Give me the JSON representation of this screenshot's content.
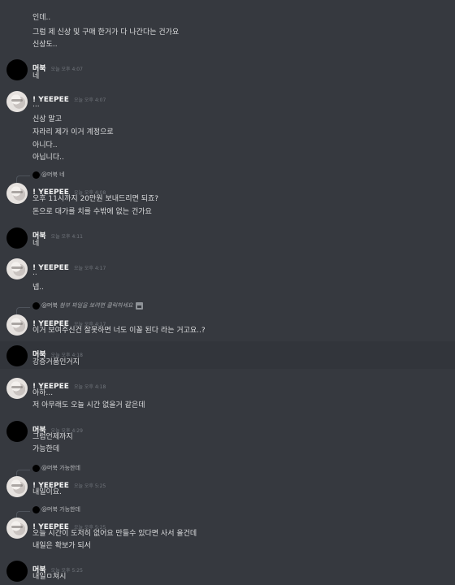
{
  "colors": {
    "background": "#36393f",
    "highlight_row": "#32353b",
    "text": "#dcddde",
    "username": "#ffffff",
    "timestamp": "#72767d"
  },
  "continuation": {
    "lines": [
      "인데..",
      "그럼 제 신상 및 구매 한거가 다 나간다는 건가요",
      "신상도.."
    ]
  },
  "messages": [
    {
      "author": "머북",
      "time": "오늘 오후 4:07",
      "avatar": "black-avatar",
      "lines": [
        "네"
      ]
    },
    {
      "author": "! YEEPEE",
      "time": "오늘 오후 4:07",
      "avatar": "anime-avatar",
      "lines": [
        "...",
        "신상 말고",
        "자라리 제가 이거 계정으로",
        "아니다..",
        "아닙니다.."
      ]
    },
    {
      "reply_to": "@머북",
      "reply_text": "네",
      "author": "! YEEPEE",
      "time": "오늘 오후 4:08",
      "avatar": "anime-avatar",
      "lines": [
        "오후 11시까지 20만원 보내드리면 되죠?",
        "돈으로 대가를 치를 수밖에 없는 건가요"
      ]
    },
    {
      "author": "머북",
      "time": "오늘 오후 4:11",
      "avatar": "black-avatar",
      "lines": [
        "네"
      ]
    },
    {
      "author": "! YEEPEE",
      "time": "오늘 오후 4:17",
      "avatar": "anime-avatar",
      "lines": [
        "..",
        "넵.."
      ]
    },
    {
      "reply_to": "@머북",
      "reply_text": "첨부 파일을 보려면 클릭하세요",
      "author": "! YEEPEE",
      "time": "오늘 오후 4:17",
      "avatar": "anime-avatar",
      "lines": [
        "이거 보여주신건 잘못하면 너도 이꼴 된다 라는 거고요..?"
      ]
    },
    {
      "author": "머북",
      "time": "오늘 오후 4:18",
      "avatar": "black-avatar",
      "lines": [
        "강증거품인거지"
      ]
    },
    {
      "author": "! YEEPEE",
      "time": "오늘 오후 4:18",
      "avatar": "anime-avatar",
      "lines": [
        "아하...",
        "저 아무래도 오늘 시간 없을거 같은데"
      ]
    },
    {
      "author": "머북",
      "time": "오늘 오후 4:29",
      "avatar": "black-avatar",
      "lines": [
        "그럼언제까지",
        "가능한데"
      ]
    },
    {
      "reply_to": "@머북",
      "reply_text": "가능한데",
      "author": "! YEEPEE",
      "time": "오늘 오후 5:25",
      "avatar": "anime-avatar",
      "lines": [
        "내일이요."
      ]
    },
    {
      "reply_to": "@머북",
      "reply_text": "가능한데",
      "author": "! YEEPEE",
      "time": "오늘 오후 5:25",
      "avatar": "anime-avatar",
      "lines": [
        "오늘 시간이 도저히 없어요 만들수 있다면 사서 올건데",
        "내일은 확보가 되서"
      ]
    },
    {
      "author": "머북",
      "time": "오늘 오후 5:25",
      "avatar": "black-avatar",
      "lines": [
        "내일ㅁ쳐시"
      ]
    }
  ]
}
